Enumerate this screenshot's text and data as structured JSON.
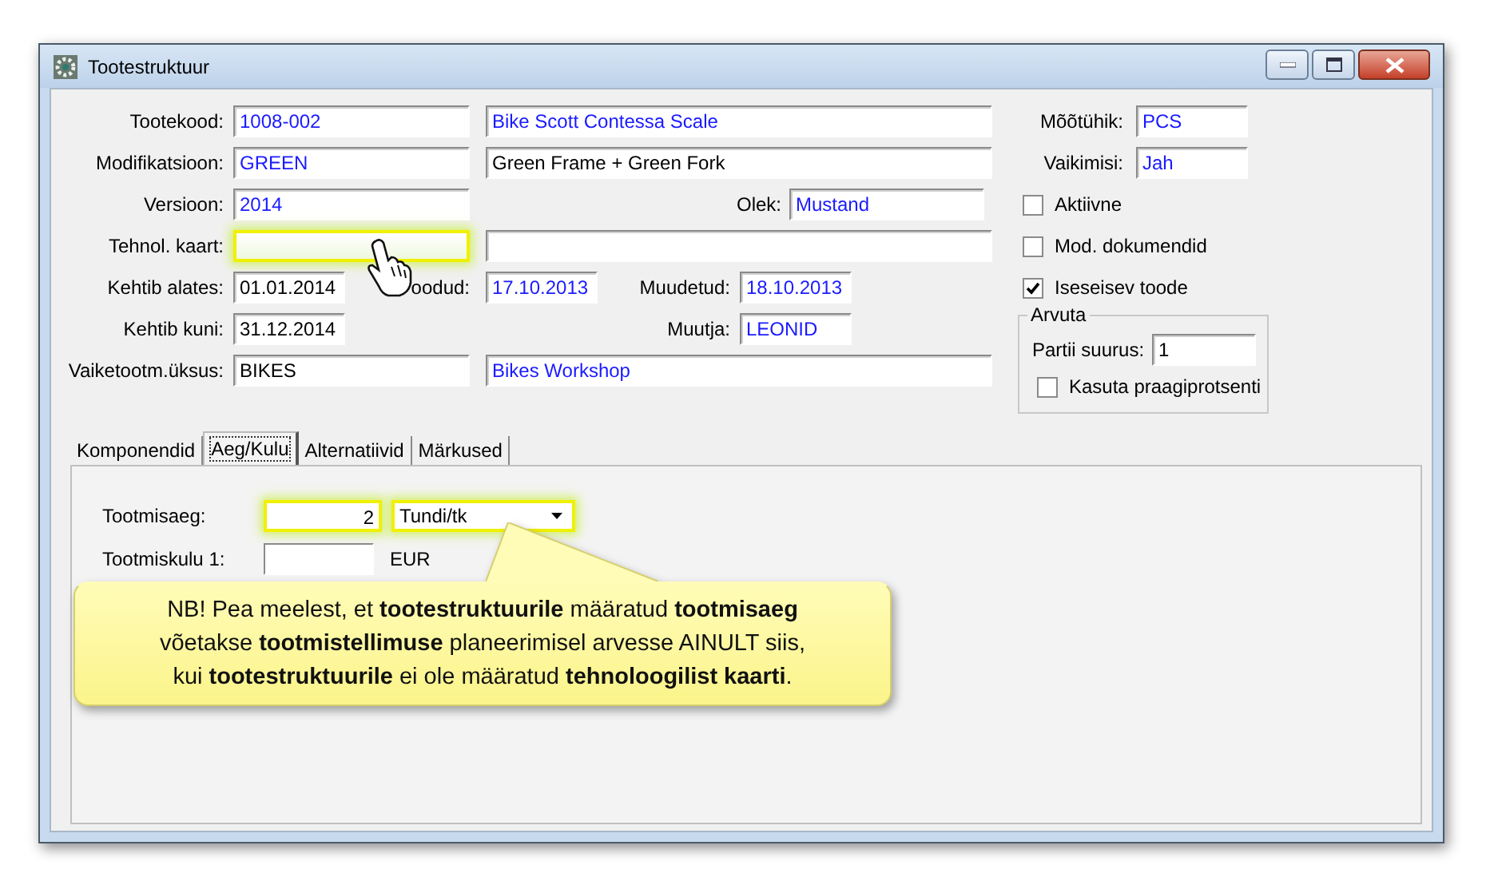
{
  "window": {
    "title": "Tootestruktuur"
  },
  "header_rows": [
    {
      "items": [
        {
          "kind": "label",
          "text": "Tootekood:"
        },
        {
          "kind": "field",
          "value": "1008-002",
          "linked": true,
          "highlighted": false
        },
        {
          "kind": "field",
          "value": "Bike Scott Contessa Scale",
          "linked": true,
          "highlighted": false
        }
      ]
    },
    {
      "items": [
        {
          "kind": "label",
          "text": "Modifikatsioon:"
        },
        {
          "kind": "field",
          "value": "GREEN",
          "linked": true,
          "highlighted": false
        },
        {
          "kind": "field",
          "value": "Green Frame + Green Fork",
          "linked": false,
          "highlighted": false
        }
      ]
    },
    {
      "items": [
        {
          "kind": "label",
          "text": "Versioon:"
        },
        {
          "kind": "field",
          "value": "2014",
          "linked": true,
          "highlighted": false
        },
        {
          "kind": "label",
          "text": "Olek:"
        },
        {
          "kind": "field",
          "value": "Mustand",
          "linked": true,
          "highlighted": false
        }
      ]
    },
    {
      "items": [
        {
          "kind": "label",
          "text": "Tehnol. kaart:"
        },
        {
          "kind": "field",
          "highlighted": true
        },
        {
          "kind": "field",
          "highlighted": false
        }
      ]
    },
    {
      "items": [
        {
          "kind": "label",
          "text": "Kehtib alates:"
        },
        {
          "kind": "field",
          "value": "01.01.2014",
          "linked": false,
          "highlighted": false
        },
        {
          "kind": "label",
          "text": "oodud:"
        },
        {
          "kind": "field",
          "value": "17.10.2013",
          "linked": true,
          "highlighted": false
        },
        {
          "kind": "label",
          "text": "Muudetud:"
        },
        {
          "kind": "field",
          "value": "18.10.2013",
          "linked": true,
          "highlighted": false
        }
      ]
    },
    {
      "items": [
        {
          "kind": "label",
          "text": "Kehtib kuni:"
        },
        {
          "kind": "field",
          "value": "31.12.2014",
          "linked": false,
          "highlighted": false
        },
        {
          "kind": "label",
          "text": "Muutja:"
        },
        {
          "kind": "field",
          "value": "LEONID",
          "linked": true,
          "highlighted": false
        }
      ]
    },
    {
      "items": [
        {
          "kind": "label",
          "text": "Vaiketootm.üksus:"
        },
        {
          "kind": "field",
          "value": "BIKES",
          "linked": false,
          "highlighted": false
        },
        {
          "kind": "field",
          "value": "Bikes Workshop",
          "linked": true,
          "highlighted": false
        }
      ]
    }
  ],
  "side_fields": [
    {
      "label": "Mõõtühik:",
      "value": "PCS",
      "linked": true
    },
    {
      "label": "Vaikimisi:",
      "value": "Jah",
      "linked": true
    }
  ],
  "side_checks": [
    {
      "label": "Aktiivne",
      "checked": false
    },
    {
      "label": "Mod. dokumendid",
      "checked": false
    },
    {
      "label": "Iseseisev toode",
      "checked": true
    }
  ],
  "calc_group": {
    "title": "Arvuta",
    "batch_label": "Partii suurus:",
    "batch_value": "1",
    "scrap_label": "Kasuta praagiprotsenti",
    "scrap_checked": false
  },
  "tabs": [
    {
      "label": "Komponendid",
      "selected": false
    },
    {
      "label": "Aeg/Kulu",
      "selected": true
    },
    {
      "label": "Alternatiivid",
      "selected": false
    },
    {
      "label": "Märkused",
      "selected": false
    }
  ],
  "time_cost": {
    "time_label": "Tootmisaeg:",
    "time_value": "2",
    "time_highlighted": true,
    "unit": "Tundi/tk",
    "unit_highlighted": true,
    "cost_label": "Tootmiskulu 1:",
    "currency": "EUR"
  },
  "callout": {
    "text": "NB! Pea meelest, et **tootestruktuurile** määratud **tootmisaeg**\nvõetakse **tootmistellimuse** planeerimisel arvesse AINULT siis,\nkui **tootestruktuurile** ei ole määratud **tehnoloogilist kaarti**."
  }
}
